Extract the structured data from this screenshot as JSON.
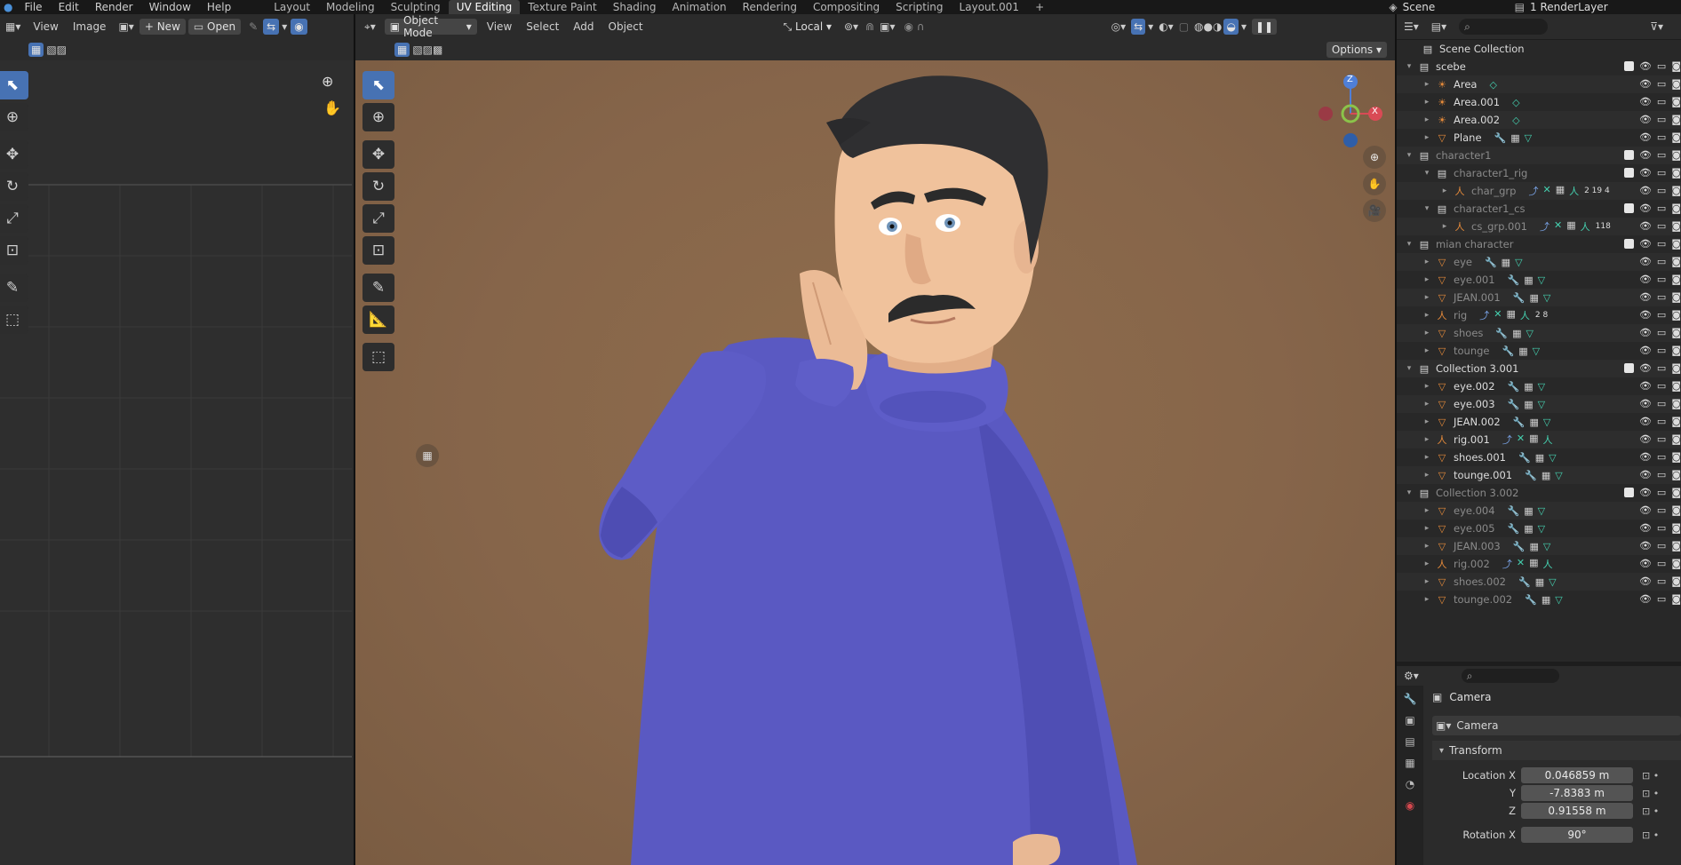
{
  "menus": [
    "File",
    "Edit",
    "Render",
    "Window",
    "Help"
  ],
  "workspaces": [
    "Layout",
    "Modeling",
    "Sculpting",
    "UV Editing",
    "Texture Paint",
    "Shading",
    "Animation",
    "Rendering",
    "Compositing",
    "Scripting",
    "Layout.001",
    "+"
  ],
  "active_workspace": "UV Editing",
  "scene_name": "Scene",
  "view_layer": "1 RenderLayer",
  "uv_editor": {
    "view": "View",
    "image": "Image",
    "new": "New",
    "open": "Open"
  },
  "viewport": {
    "mode": "Object Mode",
    "view": "View",
    "select": "Select",
    "add": "Add",
    "object": "Object",
    "orientation": "Local",
    "options": "Options",
    "gizmo_z": "Z",
    "gizmo_x": "X"
  },
  "outliner": {
    "root": "Scene Collection",
    "rows": [
      {
        "label": "scebe",
        "type": "coll",
        "indent": 0,
        "exp": "▾",
        "dim": false
      },
      {
        "label": "Area",
        "type": "lamp",
        "indent": 1,
        "exp": "▸",
        "dim": false
      },
      {
        "label": "Area.001",
        "type": "lamp",
        "indent": 1,
        "exp": "▸",
        "dim": false
      },
      {
        "label": "Area.002",
        "type": "lamp",
        "indent": 1,
        "exp": "▸",
        "dim": false
      },
      {
        "label": "Plane",
        "type": "mesh",
        "indent": 1,
        "exp": "▸",
        "dim": false
      },
      {
        "label": "character1",
        "type": "coll",
        "indent": 0,
        "exp": "▾",
        "dim": true
      },
      {
        "label": "character1_rig",
        "type": "coll",
        "indent": 1,
        "exp": "▾",
        "dim": true
      },
      {
        "label": "char_grp",
        "type": "arm",
        "indent": 2,
        "exp": "▸",
        "dim": true,
        "badge": "2 19 4"
      },
      {
        "label": "character1_cs",
        "type": "coll",
        "indent": 1,
        "exp": "▾",
        "dim": true
      },
      {
        "label": "cs_grp.001",
        "type": "arm",
        "indent": 2,
        "exp": "▸",
        "dim": true,
        "badge": "118"
      },
      {
        "label": "mian character",
        "type": "coll",
        "indent": 0,
        "exp": "▾",
        "dim": true
      },
      {
        "label": "eye",
        "type": "mesh",
        "indent": 1,
        "exp": "▸",
        "dim": true
      },
      {
        "label": "eye.001",
        "type": "mesh",
        "indent": 1,
        "exp": "▸",
        "dim": true
      },
      {
        "label": "JEAN.001",
        "type": "mesh",
        "indent": 1,
        "exp": "▸",
        "dim": true
      },
      {
        "label": "rig",
        "type": "arm",
        "indent": 1,
        "exp": "▸",
        "dim": true,
        "badge": "2 8"
      },
      {
        "label": "shoes",
        "type": "mesh",
        "indent": 1,
        "exp": "▸",
        "dim": true
      },
      {
        "label": "tounge",
        "type": "mesh",
        "indent": 1,
        "exp": "▸",
        "dim": true
      },
      {
        "label": "Collection 3.001",
        "type": "coll",
        "indent": 0,
        "exp": "▾",
        "dim": false
      },
      {
        "label": "eye.002",
        "type": "mesh",
        "indent": 1,
        "exp": "▸",
        "dim": false
      },
      {
        "label": "eye.003",
        "type": "mesh",
        "indent": 1,
        "exp": "▸",
        "dim": false
      },
      {
        "label": "JEAN.002",
        "type": "mesh",
        "indent": 1,
        "exp": "▸",
        "dim": false
      },
      {
        "label": "rig.001",
        "type": "arm",
        "indent": 1,
        "exp": "▸",
        "dim": false
      },
      {
        "label": "shoes.001",
        "type": "mesh",
        "indent": 1,
        "exp": "▸",
        "dim": false
      },
      {
        "label": "tounge.001",
        "type": "mesh",
        "indent": 1,
        "exp": "▸",
        "dim": false
      },
      {
        "label": "Collection 3.002",
        "type": "coll",
        "indent": 0,
        "exp": "▾",
        "dim": true
      },
      {
        "label": "eye.004",
        "type": "mesh",
        "indent": 1,
        "exp": "▸",
        "dim": true
      },
      {
        "label": "eye.005",
        "type": "mesh",
        "indent": 1,
        "exp": "▸",
        "dim": true
      },
      {
        "label": "JEAN.003",
        "type": "mesh",
        "indent": 1,
        "exp": "▸",
        "dim": true
      },
      {
        "label": "rig.002",
        "type": "arm",
        "indent": 1,
        "exp": "▸",
        "dim": true
      },
      {
        "label": "shoes.002",
        "type": "mesh",
        "indent": 1,
        "exp": "▸",
        "dim": true
      },
      {
        "label": "tounge.002",
        "type": "mesh",
        "indent": 1,
        "exp": "▸",
        "dim": true
      }
    ]
  },
  "properties": {
    "object_name": "Camera",
    "data_name": "Camera",
    "panel": "Transform",
    "location_x_label": "Location X",
    "location_x": "0.046859 m",
    "y_label": "Y",
    "location_y": "-7.8383 m",
    "z_label": "Z",
    "location_z": "0.91558 m",
    "rotation_x_label": "Rotation X",
    "rotation_x": "90°"
  },
  "colors": {
    "accent": "#4772b3",
    "viewport_bg": "#8a6a4a",
    "sweater": "#5b5bc4"
  }
}
